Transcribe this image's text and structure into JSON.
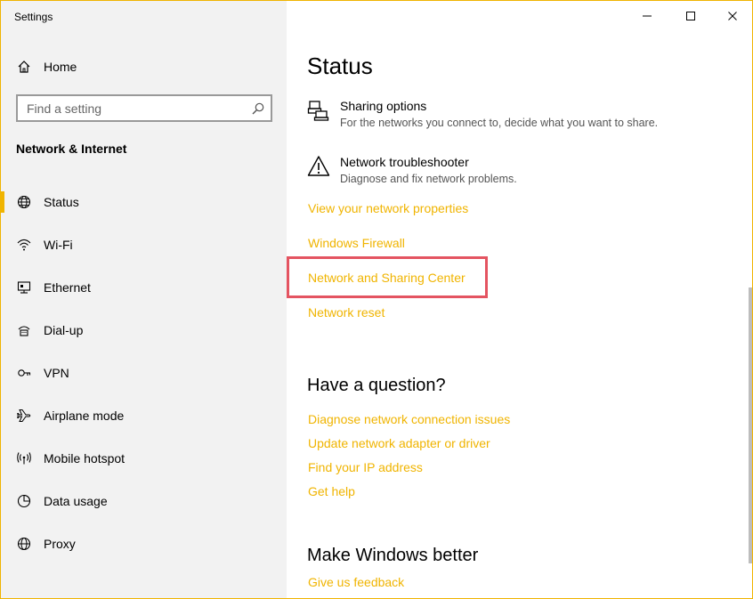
{
  "app_title": "Settings",
  "window_controls": {
    "minimize": "—",
    "maximize": "☐",
    "close": "✕"
  },
  "sidebar": {
    "home_label": "Home",
    "search_placeholder": "Find a setting",
    "section_title": "Network & Internet",
    "items": [
      {
        "label": "Status",
        "icon": "globe-icon",
        "active": true
      },
      {
        "label": "Wi-Fi",
        "icon": "wifi-icon"
      },
      {
        "label": "Ethernet",
        "icon": "ethernet-icon"
      },
      {
        "label": "Dial-up",
        "icon": "dialup-icon"
      },
      {
        "label": "VPN",
        "icon": "vpn-icon"
      },
      {
        "label": "Airplane mode",
        "icon": "airplane-icon"
      },
      {
        "label": "Mobile hotspot",
        "icon": "hotspot-icon"
      },
      {
        "label": "Data usage",
        "icon": "data-usage-icon"
      },
      {
        "label": "Proxy",
        "icon": "proxy-icon"
      }
    ]
  },
  "main": {
    "title": "Status",
    "options": [
      {
        "title": "Sharing options",
        "desc": "For the networks you connect to, decide what you want to share.",
        "icon": "sharing-icon"
      },
      {
        "title": "Network troubleshooter",
        "desc": "Diagnose and fix network problems.",
        "icon": "warning-icon"
      }
    ],
    "links": [
      "View your network properties",
      "Windows Firewall",
      "Network and Sharing Center",
      "Network reset"
    ],
    "question_heading": "Have a question?",
    "question_links": [
      "Diagnose network connection issues",
      "Update network adapter or driver",
      "Find your IP address",
      "Get help"
    ],
    "better_heading": "Make Windows better",
    "better_links": [
      "Give us feedback"
    ]
  },
  "colors": {
    "accent": "#f0b400",
    "highlight": "#e45461",
    "sidebar_bg": "#f2f2f2"
  }
}
